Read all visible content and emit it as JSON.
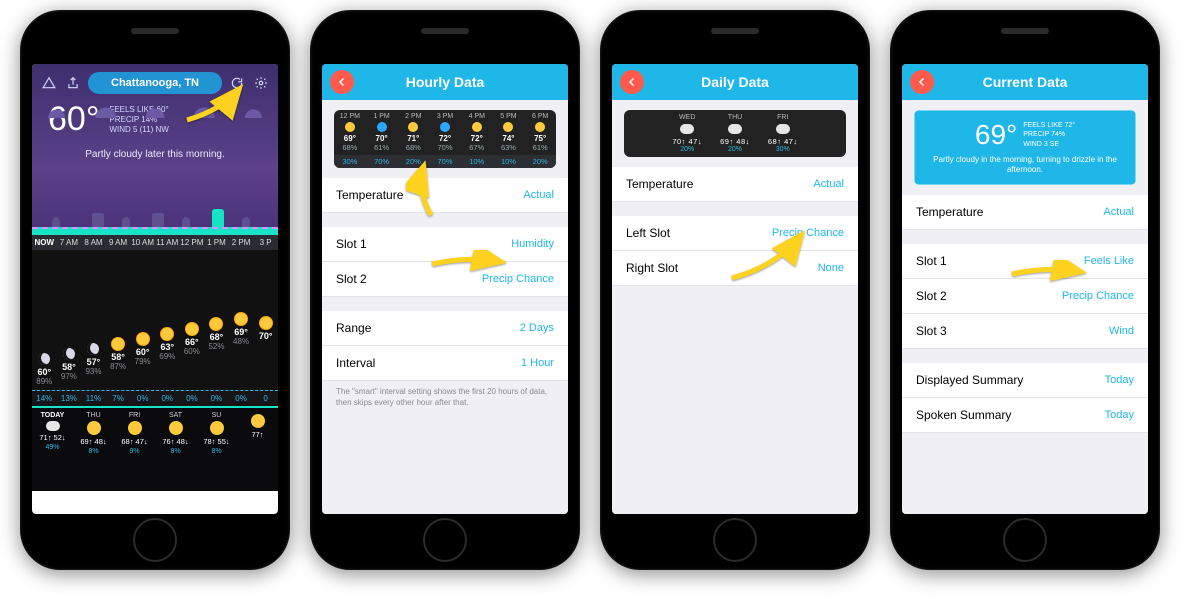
{
  "screen1": {
    "location": "Chattanooga, TN",
    "temp": "60°",
    "feels": "FEELS LIKE 60°",
    "precip": "PRECIP 14%",
    "wind": "WIND 5 (11) NW",
    "summary": "Partly cloudy later this morning.",
    "hour_labels": [
      "NOW",
      "7 AM",
      "8 AM",
      "9 AM",
      "10 AM",
      "11 AM",
      "12 PM",
      "1 PM",
      "2 PM",
      "3 P"
    ],
    "hourly": [
      {
        "t": "60°",
        "h": "89%",
        "icon": "moon"
      },
      {
        "t": "58°",
        "h": "97%",
        "icon": "moon"
      },
      {
        "t": "57°",
        "h": "93%",
        "icon": "moon"
      },
      {
        "t": "58°",
        "h": "87%",
        "icon": "sun"
      },
      {
        "t": "60°",
        "h": "79%",
        "icon": "sun"
      },
      {
        "t": "63°",
        "h": "69%",
        "icon": "sun"
      },
      {
        "t": "66°",
        "h": "60%",
        "icon": "sun"
      },
      {
        "t": "68°",
        "h": "52%",
        "icon": "sun"
      },
      {
        "t": "69°",
        "h": "48%",
        "icon": "sun"
      },
      {
        "t": "70°",
        "h": "",
        "icon": "sun"
      }
    ],
    "precip_row": [
      "14%",
      "13%",
      "11%",
      "7%",
      "0%",
      "0%",
      "0%",
      "0%",
      "0%",
      "0"
    ],
    "daily": [
      {
        "lbl": "TODAY",
        "hi": "71↑",
        "lo": "52↓",
        "pp": "49%",
        "icon": "cloud"
      },
      {
        "lbl": "THU",
        "hi": "69↑",
        "lo": "48↓",
        "pp": "8%",
        "icon": "sun"
      },
      {
        "lbl": "FRI",
        "hi": "68↑",
        "lo": "47↓",
        "pp": "9%",
        "icon": "sun"
      },
      {
        "lbl": "SAT",
        "hi": "76↑",
        "lo": "48↓",
        "pp": "8%",
        "icon": "sun"
      },
      {
        "lbl": "SU",
        "hi": "78↑",
        "lo": "55↓",
        "pp": "8%",
        "icon": "sun"
      },
      {
        "lbl": "",
        "hi": "77↑",
        "lo": "",
        "pp": "",
        "icon": "sun"
      }
    ]
  },
  "screen2": {
    "title": "Hourly Data",
    "preview": {
      "hours": [
        "12 PM",
        "1 PM",
        "2 PM",
        "3 PM",
        "4 PM",
        "5 PM",
        "6 PM"
      ],
      "icons": [
        "sun",
        "rain",
        "sun",
        "rain",
        "sun",
        "sun",
        "sun"
      ],
      "temps": [
        "69°",
        "70°",
        "71°",
        "72°",
        "72°",
        "74°",
        "75°"
      ],
      "hums": [
        "68%",
        "61%",
        "68%",
        "70%",
        "67%",
        "63%",
        "61%"
      ],
      "row2": [
        "30%",
        "70%",
        "20%",
        "70%",
        "10%",
        "10%",
        "20%"
      ]
    },
    "rows": [
      {
        "label": "Temperature",
        "value": "Actual"
      },
      {
        "label": "Slot 1",
        "value": "Humidity"
      },
      {
        "label": "Slot 2",
        "value": "Precip Chance"
      },
      {
        "label": "Range",
        "value": "2 Days"
      },
      {
        "label": "Interval",
        "value": "1 Hour"
      }
    ],
    "footnote": "The \"smart\" interval setting shows the first 20 hours of data, then skips every other hour after that."
  },
  "screen3": {
    "title": "Daily Data",
    "preview": [
      {
        "lbl": "WED",
        "hi": "70↑",
        "lo": "47↓",
        "pp": "20%"
      },
      {
        "lbl": "THU",
        "hi": "69↑",
        "lo": "48↓",
        "pp": "20%"
      },
      {
        "lbl": "FRI",
        "hi": "68↑",
        "lo": "47↓",
        "pp": "30%"
      }
    ],
    "rows": [
      {
        "label": "Temperature",
        "value": "Actual"
      },
      {
        "label": "Left Slot",
        "value": "Precip Chance"
      },
      {
        "label": "Right Slot",
        "value": "None"
      }
    ]
  },
  "screen4": {
    "title": "Current Data",
    "preview": {
      "temp": "69°",
      "feels": "FEELS LIKE 72°",
      "precip": "PRECIP 74%",
      "wind": "WIND 3 SE",
      "summary": "Partly cloudy in the morning, turning to drizzle in the afternoon."
    },
    "rows": [
      {
        "label": "Temperature",
        "value": "Actual"
      },
      {
        "label": "Slot 1",
        "value": "Feels Like"
      },
      {
        "label": "Slot 2",
        "value": "Precip Chance"
      },
      {
        "label": "Slot 3",
        "value": "Wind"
      },
      {
        "label": "Displayed Summary",
        "value": "Today"
      },
      {
        "label": "Spoken Summary",
        "value": "Today"
      }
    ]
  }
}
